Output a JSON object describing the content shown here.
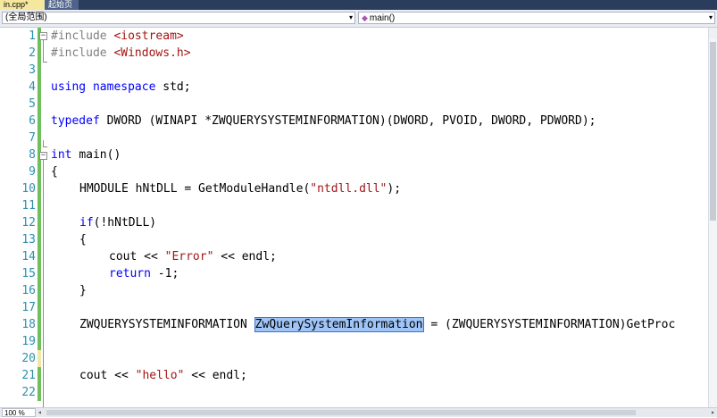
{
  "tabs": [
    {
      "label": "in.cpp*",
      "active": true
    },
    {
      "label": "起始页",
      "active": false
    }
  ],
  "nav": {
    "scope": "(全局范围)",
    "function": "main()",
    "function_icon": "method-icon",
    "dropdown_arrow": "▾"
  },
  "editor": {
    "zoom": "100 %",
    "lines": [
      {
        "n": "1",
        "change": "green"
      },
      {
        "n": "2",
        "change": "green"
      },
      {
        "n": "3",
        "change": "green"
      },
      {
        "n": "4",
        "change": "green"
      },
      {
        "n": "5",
        "change": "green"
      },
      {
        "n": "6",
        "change": "green"
      },
      {
        "n": "7",
        "change": "green"
      },
      {
        "n": "8",
        "change": "green"
      },
      {
        "n": "9",
        "change": "green"
      },
      {
        "n": "10",
        "change": "green"
      },
      {
        "n": "11",
        "change": "green"
      },
      {
        "n": "12",
        "change": "green"
      },
      {
        "n": "13",
        "change": "green"
      },
      {
        "n": "14",
        "change": "green"
      },
      {
        "n": "15",
        "change": "green"
      },
      {
        "n": "16",
        "change": "green"
      },
      {
        "n": "17",
        "change": "green"
      },
      {
        "n": "18",
        "change": "green"
      },
      {
        "n": "19",
        "change": "green"
      },
      {
        "n": "20",
        "change": "yellow"
      },
      {
        "n": "21",
        "change": "green"
      },
      {
        "n": "22",
        "change": "green"
      }
    ],
    "code": {
      "l1_pp": "#include",
      "l1_lib": "<iostream>",
      "l2_pp": "#include",
      "l2_lib": "<Windows.h>",
      "l4_kw1": "using",
      "l4_kw2": "namespace",
      "l4_rest": "std;",
      "l6_kw": "typedef",
      "l6_rest": "DWORD (WINAPI *ZWQUERYSYSTEMINFORMATION)(DWORD, PVOID, DWORD, PDWORD);",
      "l8_kw": "int",
      "l8_rest": "main()",
      "l9": "{",
      "l10_pre": "HMODULE hNtDLL = GetModuleHandle(",
      "l10_str": "\"ntdll.dll\"",
      "l10_post": ");",
      "l12_kw": "if",
      "l12_rest": "(!hNtDLL)",
      "l13": "{",
      "l14_pre": "cout << ",
      "l14_str": "\"Error\"",
      "l14_post": " << endl;",
      "l15_kw": "return",
      "l15_rest": "-1;",
      "l16": "}",
      "l18_pre": "ZWQUERYSYSTEMINFORMATION ",
      "l18_sel": "ZwQuerySystemInformation",
      "l18_post": " = (ZWQUERYSYSTEMINFORMATION)GetProc",
      "l21_pre": "cout << ",
      "l21_str": "\"hello\"",
      "l21_post": " << endl;"
    }
  }
}
